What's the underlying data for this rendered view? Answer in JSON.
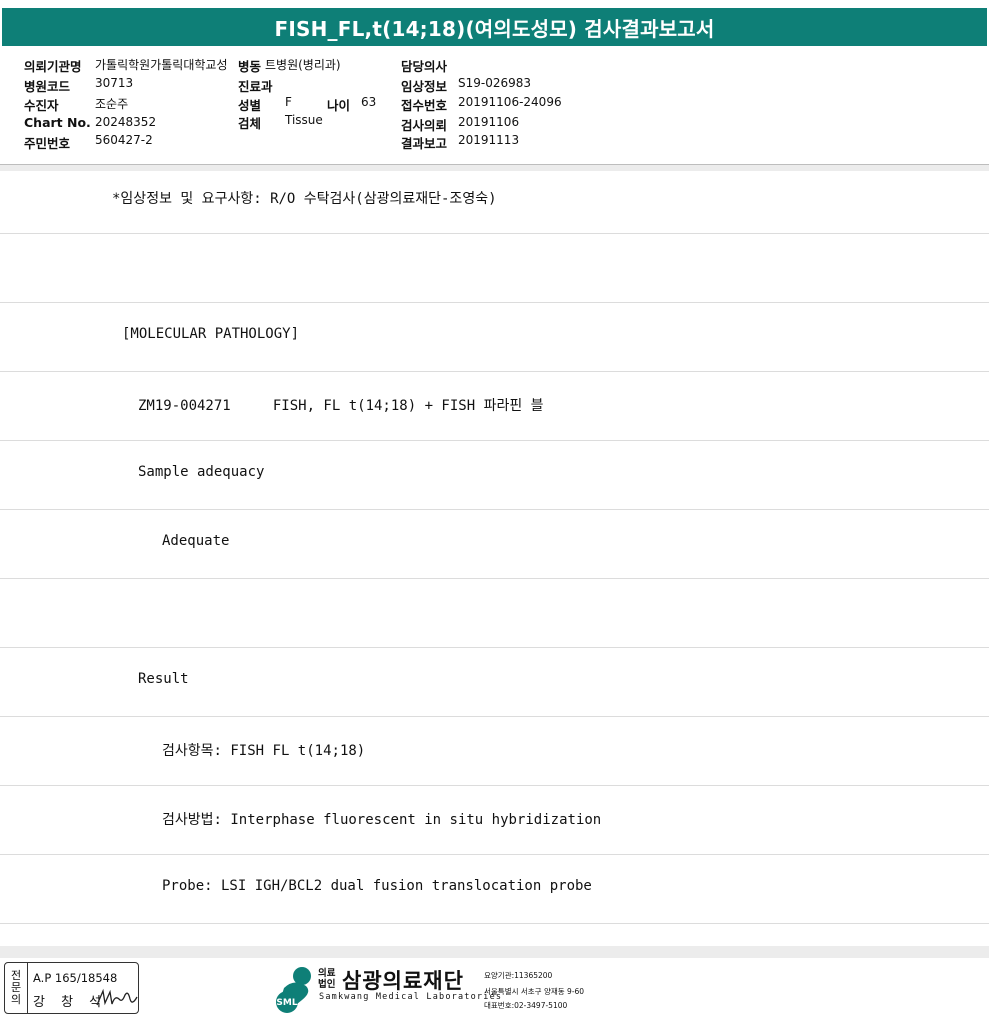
{
  "title": "FISH_FL,t(14;18)(여의도성모) 검사결과보고서",
  "header": {
    "institution_label": "의뢰기관명",
    "institution_value": "가톨릭학원가톨릭대학교성",
    "ward_label": "병동",
    "ward_value": "트병원(병리과)",
    "hospital_code_label": "병원코드",
    "hospital_code_value": "30713",
    "examinee_label": "수진자",
    "examinee_value": "조순주",
    "chart_no_label": "Chart No.",
    "chart_no_value": "20248352",
    "resident_no_label": "주민번호",
    "resident_no_value": "560427-2",
    "department_label": "진료과",
    "department_value": "",
    "sex_label": "성별",
    "sex_value": "F",
    "age_label": "나이",
    "age_value": "63",
    "specimen_label": "검체",
    "specimen_value": "Tissue",
    "doctor_label": "담당의사",
    "doctor_value": "",
    "clinical_info_label": "임상정보",
    "clinical_info_value": "S19-026983",
    "receipt_no_label": "접수번호",
    "receipt_no_value": "20191106-24096",
    "request_date_label": "검사의뢰",
    "request_date_value": "20191106",
    "report_date_label": "결과보고",
    "report_date_value": "20191113"
  },
  "report_lines": [
    "*임상정보 및 요구사항: R/O 수탁검사(삼광의료재단-조영숙)",
    "",
    "[MOLECULAR PATHOLOGY]",
    "ZM19-004271     FISH, FL t(14;18) + FISH 파라핀 블",
    "Sample adequacy",
    "Adequate",
    "",
    "Result",
    "검사항목: FISH FL t(14;18)",
    "검사방법: Interphase fluorescent in situ hybridization",
    "Probe: LSI IGH/BCL2 dual fusion translocation probe"
  ],
  "footer": {
    "specialist_vertical": [
      "전",
      "문",
      "의"
    ],
    "ap_number": "A.P 165/18548",
    "doctor_name": "강 창 석",
    "logo_badge": "SML",
    "logo_small_top": "의료",
    "logo_small_bottom": "법인",
    "logo_name": "삼광의료재단",
    "logo_english": "Samkwang Medical Laboratories",
    "care_code": "요양기관:11365200",
    "address": "서울특별시 서초구 양재동 9-60",
    "phone": "대표번호:02-3497-5100",
    "brand_color": "#0e7f77"
  }
}
